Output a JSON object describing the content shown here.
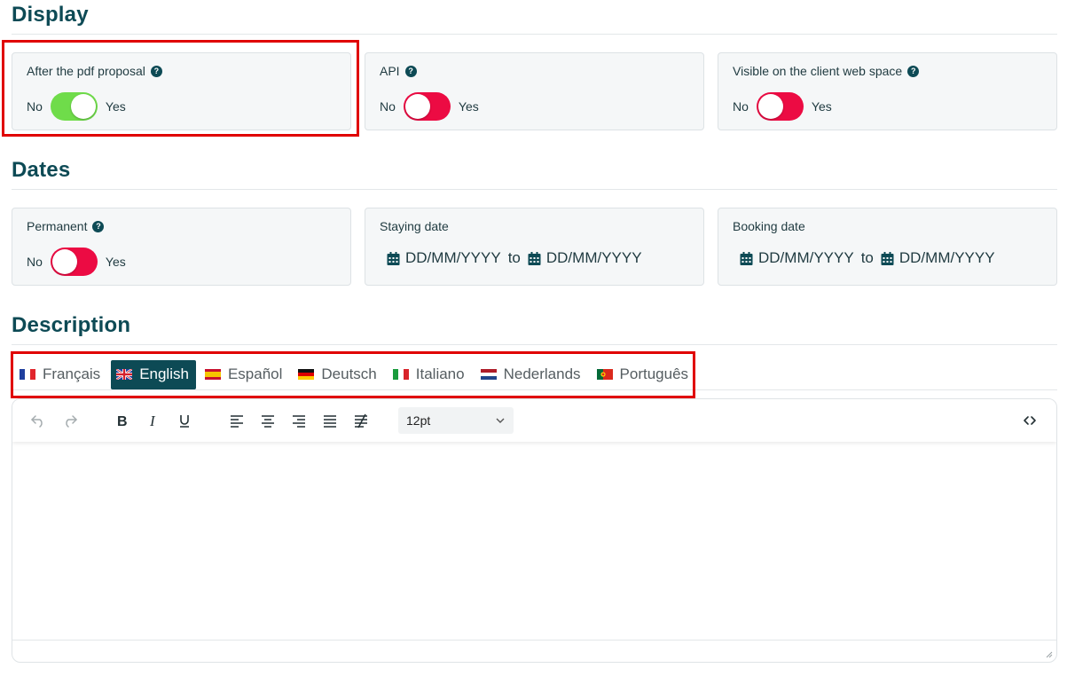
{
  "sections": {
    "display": "Display",
    "dates": "Dates",
    "description": "Description"
  },
  "display": {
    "pdf": {
      "label": "After the pdf proposal",
      "no": "No",
      "yes": "Yes",
      "state": "on"
    },
    "api": {
      "label": "API",
      "no": "No",
      "yes": "Yes",
      "state": "off"
    },
    "client": {
      "label": "Visible on the client web space",
      "no": "No",
      "yes": "Yes",
      "state": "off"
    }
  },
  "dates": {
    "permanent": {
      "label": "Permanent",
      "no": "No",
      "yes": "Yes",
      "state": "off"
    },
    "staying": {
      "label": "Staying date",
      "from": "DD/MM/YYYY",
      "to_word": "to",
      "to": "DD/MM/YYYY"
    },
    "booking": {
      "label": "Booking date",
      "from": "DD/MM/YYYY",
      "to_word": "to",
      "to": "DD/MM/YYYY"
    }
  },
  "languages": [
    {
      "label": "Français",
      "flag": "fr",
      "active": false
    },
    {
      "label": "English",
      "flag": "gb",
      "active": true
    },
    {
      "label": "Español",
      "flag": "es",
      "active": false
    },
    {
      "label": "Deutsch",
      "flag": "de",
      "active": false
    },
    {
      "label": "Italiano",
      "flag": "it",
      "active": false
    },
    {
      "label": "Nederlands",
      "flag": "nl",
      "active": false
    },
    {
      "label": "Português",
      "flag": "pt",
      "active": false
    }
  ],
  "editor": {
    "font_size": "12pt",
    "icons": [
      "undo-icon",
      "redo-icon",
      "bold-icon",
      "italic-icon",
      "underline-icon",
      "align-left-icon",
      "align-center-icon",
      "align-right-icon",
      "justify-icon",
      "clear-format-icon",
      "source-code-icon"
    ]
  },
  "colors": {
    "accent": "#0d4a55",
    "toggle_on": "#6fdc4a",
    "toggle_off": "#ec0b43",
    "highlight": "#e00000"
  }
}
